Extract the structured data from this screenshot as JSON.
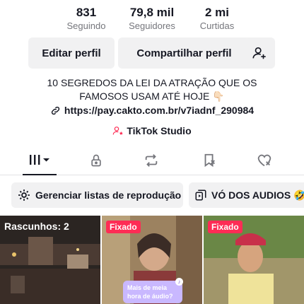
{
  "stats": [
    {
      "value": "831",
      "label": "Seguindo"
    },
    {
      "value": "79,8 mil",
      "label": "Seguidores"
    },
    {
      "value": "2 mi",
      "label": "Curtidas"
    }
  ],
  "actions": {
    "edit_label": "Editar perfil",
    "share_label": "Compartilhar perfil",
    "add_friend_icon": "add-user-icon"
  },
  "bio": {
    "text": "10 SEGREDOS DA LEI DA ATRAÇÃO QUE OS FAMOSOS USAM ATÉ HOJE 👇🏻",
    "link": "https://pay.cakto.com.br/v7iadnf_290984",
    "studio_label": "TikTok Studio"
  },
  "tabs": [
    {
      "name": "videos",
      "icon": "grid-icon",
      "active": true
    },
    {
      "name": "private",
      "icon": "lock-icon"
    },
    {
      "name": "reposts",
      "icon": "repost-icon"
    },
    {
      "name": "favorites",
      "icon": "bookmark-icon"
    },
    {
      "name": "liked",
      "icon": "heart-icon"
    }
  ],
  "pills": {
    "playlists_label": "Gerenciar listas de reprodução",
    "playlist_label": "VÓ DOS AUDIOS 🤣"
  },
  "grid": {
    "drafts_label": "Rascunhos: 2",
    "pinned_label": "Fixado",
    "bubble_text": "Mais de meia hora de áudio?"
  },
  "colors": {
    "pin": "#fe2c55",
    "text": "#161823",
    "secondary": "#75767c",
    "button_bg": "#f1f1f2"
  }
}
